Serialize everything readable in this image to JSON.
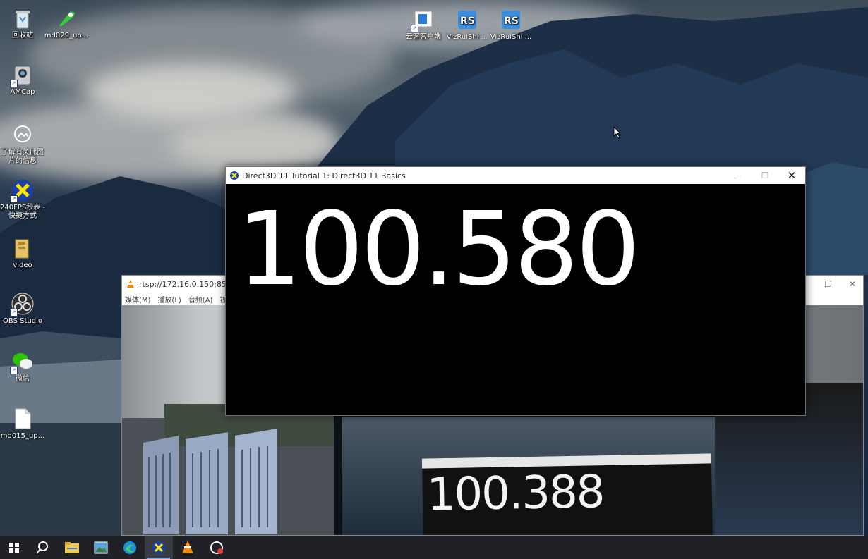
{
  "desktop": {
    "icons": [
      {
        "label": "回收站"
      },
      {
        "label": "md029_up..."
      },
      {
        "label": "AMCap"
      },
      {
        "label": "了解有关此图片的信息"
      },
      {
        "label": "240FPS秒表 - 快捷方式"
      },
      {
        "label": "video"
      },
      {
        "label": "OBS Studio"
      },
      {
        "label": "微信"
      },
      {
        "label": "md015_up..."
      },
      {
        "label": "云客客户端"
      },
      {
        "label": "VizRuiShi ..."
      },
      {
        "label": "VizRuiShi ..."
      }
    ]
  },
  "vlc_window": {
    "title": "rtsp://172.16.0.150:8555/",
    "menus": [
      "媒体(M)",
      "播放(L)",
      "音频(A)",
      "视"
    ],
    "video_counter": "100.388"
  },
  "d3d_window": {
    "title": "Direct3D 11 Tutorial 1: Direct3D 11 Basics",
    "counter": "100.580",
    "minimize": "–",
    "maximize": "☐",
    "close": "✕"
  },
  "taskbar": {
    "items": [
      "start-icon",
      "search-icon",
      "file-explorer-icon",
      "photos-icon",
      "edge-icon",
      "stopwatch-icon",
      "vlc-icon",
      "camera-tool-icon"
    ],
    "active": "stopwatch-icon"
  }
}
